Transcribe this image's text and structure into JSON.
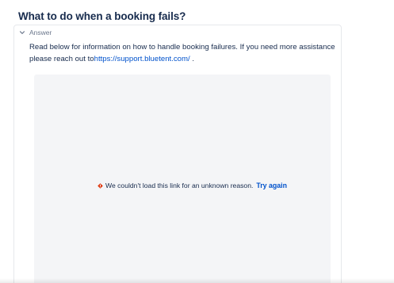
{
  "question": {
    "title": "What to do when a booking fails?"
  },
  "answer": {
    "toggle_label": "Answer",
    "text_intro": "Read below for information on how to handle booking failures.  If you need more assistance please reach out to",
    "link_text": "https://support.bluetent.com/",
    "text_end": " ."
  },
  "embed": {
    "error_message": "We couldn't load this link for an unknown reason.",
    "retry_label": "Try again",
    "error_color": "#de350b"
  },
  "icons": {
    "toggle": "chevron-down-icon",
    "error": "error-diamond-icon"
  },
  "colors": {
    "link": "#0052cc",
    "text": "#172b4d",
    "muted": "#6b778c",
    "embed_bg": "#f4f5f7"
  }
}
